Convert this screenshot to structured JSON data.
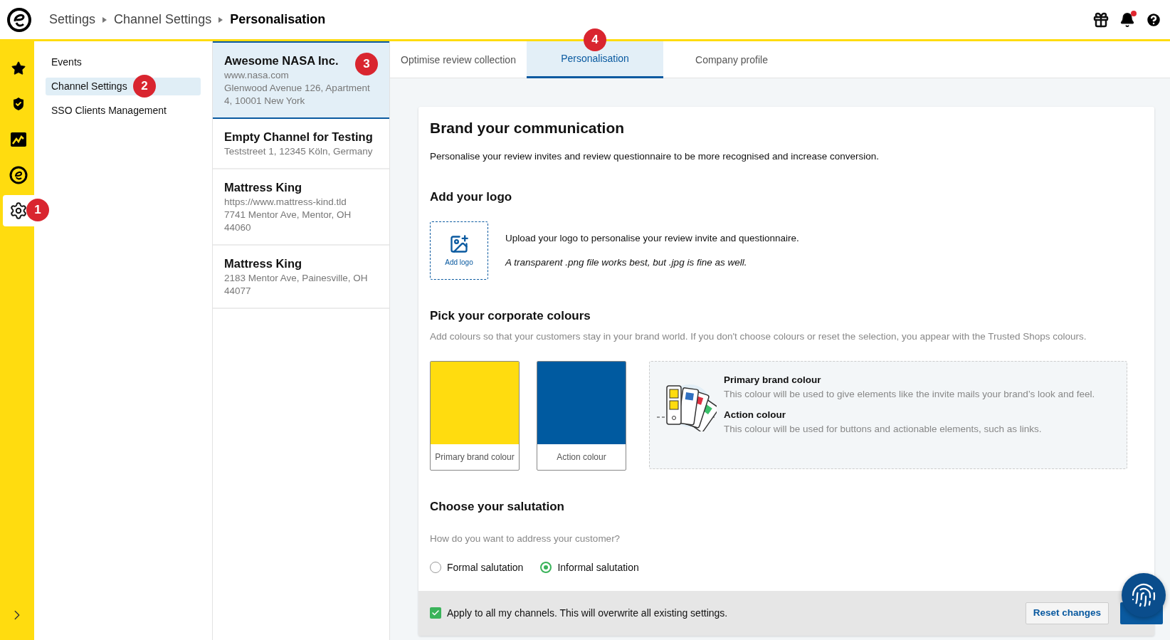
{
  "header": {
    "breadcrumbs": [
      {
        "label": "Settings",
        "current": false
      },
      {
        "label": "Channel Settings",
        "current": false
      },
      {
        "label": "Personalisation",
        "current": true
      }
    ],
    "bell_unread": true
  },
  "rail": [
    {
      "kind": "star",
      "selected": false
    },
    {
      "kind": "shield",
      "selected": false
    },
    {
      "kind": "chart",
      "selected": false
    },
    {
      "kind": "logo",
      "selected": false
    },
    {
      "kind": "settings",
      "selected": true,
      "badge": "1"
    }
  ],
  "submenu": [
    {
      "label": "Events",
      "selected": false
    },
    {
      "label": "Channel Settings",
      "selected": true,
      "badge": "2"
    },
    {
      "label": "SSO Clients Management",
      "selected": false
    }
  ],
  "channels": [
    {
      "name": "Awesome NASA Inc.",
      "lines": [
        "www.nasa.com",
        "Glenwood Avenue 126, Apartment 4, 10001 New York"
      ],
      "selected": true,
      "badge": "3"
    },
    {
      "name": "Empty Channel for Testing",
      "lines": [
        "Teststreet 1, 12345 Köln, Germany"
      ],
      "selected": false
    },
    {
      "name": "Mattress King",
      "lines": [
        "https://www.mattress-kind.tld",
        "7741 Mentor Ave, Mentor, OH 44060"
      ],
      "selected": false
    },
    {
      "name": "Mattress King",
      "lines": [
        "2183 Mentor Ave, Painesville, OH 44077"
      ],
      "selected": false
    }
  ],
  "tabs": [
    {
      "label": "Optimise review collection",
      "selected": false
    },
    {
      "label": "Personalisation",
      "selected": true,
      "badge": "4"
    },
    {
      "label": "Company profile",
      "selected": false
    }
  ],
  "card": {
    "title": "Brand your communication",
    "intro": "Personalise your review invites and review questionnaire to be more recognised and increase conversion.",
    "logo": {
      "heading": "Add your logo",
      "button": "Add logo",
      "text": "Upload your logo to personalise your review invite and questionnaire.",
      "hint": "A transparent .png file works best, but .jpg is fine as well."
    },
    "colours": {
      "heading": "Pick your corporate colours",
      "description": "Add colours so that your customers stay in your brand world. If you don't choose colours or reset the selection, you appear with the Trusted Shops colours.",
      "swatches": [
        {
          "label": "Primary brand colour",
          "color": "#ffdc0f"
        },
        {
          "label": "Action colour",
          "color": "#005aa0"
        }
      ],
      "info": [
        {
          "title": "Primary brand colour",
          "text": "This colour will be used to give elements like the invite mails your brand’s look and feel."
        },
        {
          "title": "Action colour",
          "text": "This colour will be used for buttons and actionable elements, such as links."
        }
      ]
    },
    "salutation": {
      "heading": "Choose your salutation",
      "question": "How do you want to address your customer?",
      "options": [
        {
          "label": "Formal salutation",
          "selected": false
        },
        {
          "label": "Informal salutation",
          "selected": true
        }
      ]
    },
    "footer": {
      "apply": {
        "label": "Apply to all my channels. This will overwrite all existing settings.",
        "checked": true
      },
      "reset": "Reset changes"
    }
  }
}
